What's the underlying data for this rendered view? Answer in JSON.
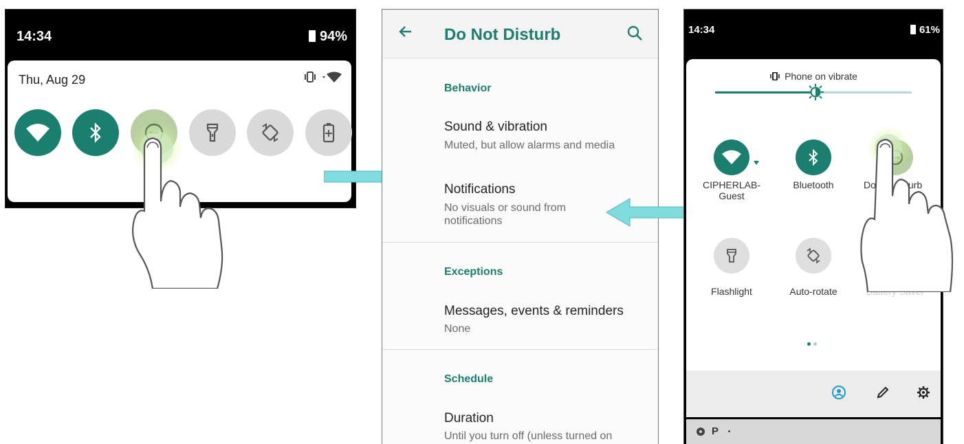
{
  "panel1": {
    "time": "14:34",
    "battery": "94%",
    "date": "Thu, Aug 29",
    "tiles": [
      {
        "name": "wifi",
        "state": "on"
      },
      {
        "name": "bluetooth",
        "state": "on"
      },
      {
        "name": "do-not-disturb",
        "state": "active"
      },
      {
        "name": "flashlight",
        "state": "off"
      },
      {
        "name": "auto-rotate",
        "state": "off"
      },
      {
        "name": "battery-saver",
        "state": "off"
      }
    ]
  },
  "panel2": {
    "title": "Do Not Disturb",
    "sections": {
      "behavior": "Behavior",
      "exceptions": "Exceptions",
      "schedule": "Schedule"
    },
    "items": {
      "sound_title": "Sound & vibration",
      "sound_sub": "Muted, but allow alarms and media",
      "notif_title": "Notifications",
      "notif_sub": "No visuals or sound from notifications",
      "messages_title": "Messages, events & reminders",
      "messages_sub": "None",
      "duration_title": "Duration",
      "duration_sub": "Until you turn off (unless turned on"
    }
  },
  "panel3": {
    "time": "14:34",
    "battery": "61%",
    "ringer": "Phone on vibrate",
    "tiles": {
      "wifi": "CIPHERLAB-Guest",
      "bluetooth": "Bluetooth",
      "dnd_left": "Do",
      "dnd_right": "sturb",
      "flashlight": "Flashlight",
      "autorotate": "Auto-rotate",
      "battery_saver": "Battery Saver"
    },
    "notif_letter": "P"
  },
  "colors": {
    "accent": "#1a7f6e",
    "arrow": "#7fdcdc"
  }
}
